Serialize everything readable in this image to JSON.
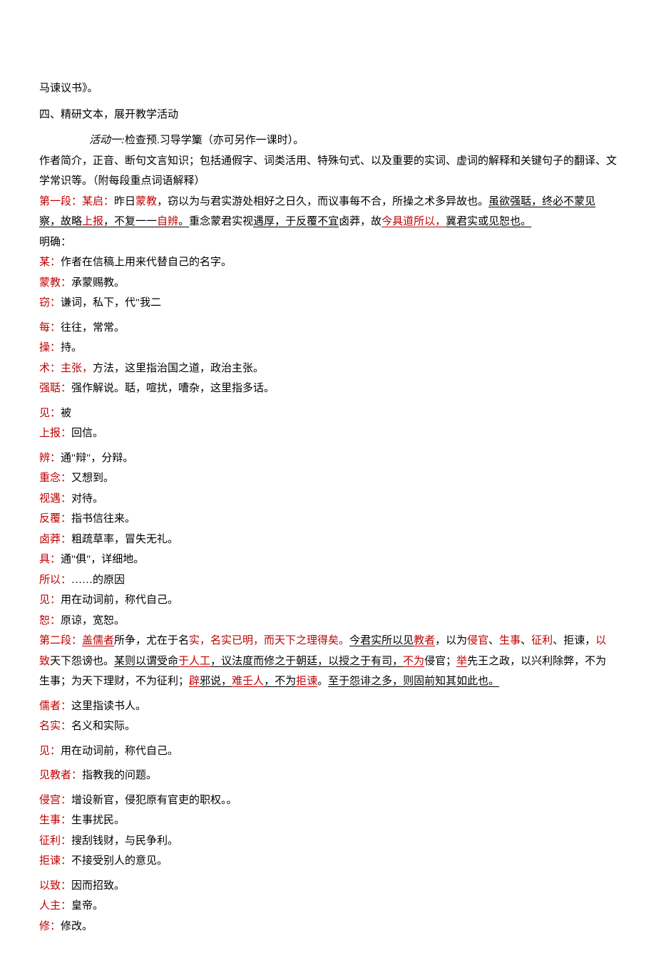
{
  "top_line": "马谏议书》。",
  "heading4": "四、精研文本，展开教学活动",
  "activity1_a": "活动一:",
  "activity1_b": "检查预.习导学篥（亦可另作一课时）。",
  "intro1": "作者简介，正音、断句文言知识；包括通假字、词类活用、特殊句式、以及重要的实词、虚词的解释和关键句子的翻译、文学常识等。（附每段重点词语解释）",
  "p1": {
    "label": "第一段：",
    "s1_a": "某启：",
    "s1_b": "昨日",
    "s1_c": "蒙教",
    "s1_d": "，窃以为与君实游处相好之日久，而议事每不合，所操之术多异故也。",
    "s2_a": "虽欲强聒，终必不蒙见察，故略",
    "s2_b": "上报",
    "s2_c": "，不复一一",
    "s2_d": "自辨",
    "s2_e": "。",
    "s3_a": "重念蒙君实视遇厚，于反覆不宜卤莽，故今具道所以，",
    "s3_a_pre": "重念蒙君实视",
    "s3_a_u1": "遇厚，于反覆不宜",
    "s3_a_mid": "卤莽，故",
    "s3_a_u2": "今具道所以，",
    "s3_b": "冀君实或见恕也。"
  },
  "mingque": "明确：",
  "vocab1": [
    {
      "term": "某：",
      "def": "作者在信稿上用来代替自己的名字。"
    },
    {
      "term": "蒙教：",
      "def": "承蒙赐教。"
    },
    {
      "term": "窃：",
      "def": "谦词，私下，代\"我二"
    },
    {
      "term": "每：",
      "def": "往往，常常。"
    },
    {
      "term": "操：",
      "def": "持。"
    }
  ],
  "shu_line": {
    "a": "术：",
    "b": "主张，",
    "c": "方法，这里指治国之道，政治主张。"
  },
  "vocab1b": [
    {
      "term": "强聒：",
      "def": "强作解说。聒，喧扰，嘈杂，这里指多话。"
    },
    {
      "term": "见：",
      "def": "被"
    },
    {
      "term": "上报：",
      "def": "回信。"
    },
    {
      "term": "辨：",
      "def": "通\"辩\"，分辩。"
    },
    {
      "term": "重念：",
      "def": "又想到。"
    },
    {
      "term": "视遇：",
      "def": "对待。"
    },
    {
      "term": "反覆：",
      "def": "指书信往来。"
    },
    {
      "term": "卤莽：",
      "def": "粗疏草率，冒失无礼。"
    },
    {
      "term": "具：",
      "def": "通\"俱\"，详细地。"
    },
    {
      "term": "所以：",
      "def": "……的原因"
    },
    {
      "term": "见：",
      "def": "用在动词前，称代自己。"
    },
    {
      "term": "恕：",
      "def": "原谅，宽恕。"
    }
  ],
  "p2": {
    "label": "第二段：",
    "a1": "盖儒者",
    "a2": "所争，尤在于名",
    "a3": "实，名实已明，而天下之理得矣。",
    "b1": "今君实所以见",
    "b2": "教者",
    "b3": "，以为",
    "b4": "侵官",
    "b5": "、",
    "b6": "生事",
    "b7": "、",
    "b8": "征利",
    "b9": "、拒谏，",
    "b10": "以致",
    "b11": "天下怨谤也。",
    "c1": "某则以谓受命",
    "c2": "于人工",
    "c3": "，议法度而修之于朝廷，",
    "c4": "以授之于有司，",
    "c5": "不为",
    "c6": "侵官；",
    "c7": "举",
    "c8": "先王之政，以兴利除弊，不为生事；为天下理财，不为征利；",
    "c9": "辟",
    "c10": "邪说，",
    "c11": "难壬人",
    "c12": "，不为",
    "c13": "拒谏",
    "c14": "。",
    "d1": "至于怨诽之多，则固前知其如此也。"
  },
  "vocab2": [
    {
      "term": "儒者：",
      "def": "这里指读书人。"
    },
    {
      "term": "名实：",
      "def": "名义和实际。"
    },
    {
      "term": "见：",
      "def": "用在动词前，称代自己。"
    },
    {
      "term": "见教者：",
      "def": "指教我的问题。"
    },
    {
      "term": "侵宫：",
      "def": "增设新官，侵犯原有官吏的职权。。"
    },
    {
      "term": "生事：",
      "def": "生事扰民。"
    },
    {
      "term": "征利：",
      "def": "搜刮钱财，与民争利。"
    },
    {
      "term": "拒谏：",
      "def": "不接受别人的意见。"
    },
    {
      "term": "以致：",
      "def": "因而招致。"
    },
    {
      "term": "人主：",
      "def": "皇帝。"
    },
    {
      "term": "修：",
      "def": "修改。"
    }
  ]
}
